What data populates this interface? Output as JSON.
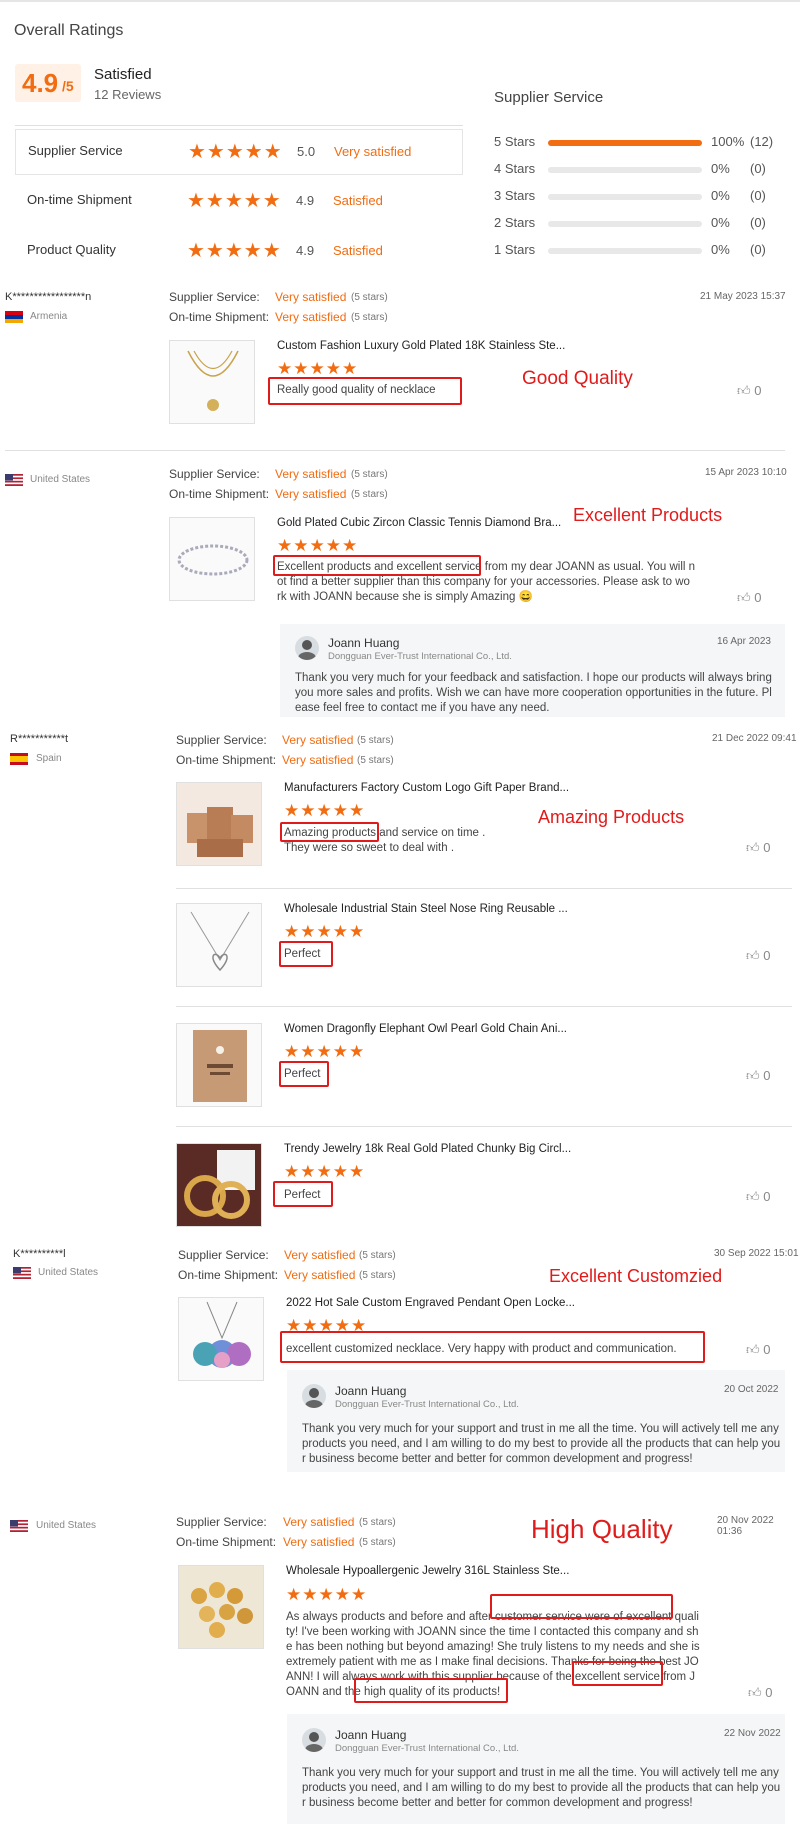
{
  "overall": {
    "title": "Overall Ratings",
    "score": "4.9",
    "score_den": "/5",
    "label": "Satisfied",
    "reviews": "12 Reviews"
  },
  "ratings": [
    {
      "name": "Supplier Service",
      "value": "5.0",
      "desc": "Very satisfied",
      "stars": 5
    },
    {
      "name": "On-time Shipment",
      "value": "4.9",
      "desc": "Satisfied",
      "stars": 5
    },
    {
      "name": "Product Quality",
      "value": "4.9",
      "desc": "Satisfied",
      "stars": 5
    }
  ],
  "supplier_service": {
    "title": "Supplier Service",
    "bars": [
      {
        "label": "5 Stars",
        "fraction": 1.0,
        "pct": "100%",
        "count": "(12)"
      },
      {
        "label": "4 Stars",
        "fraction": 0,
        "pct": "0%",
        "count": "(0)"
      },
      {
        "label": "3 Stars",
        "fraction": 0,
        "pct": "0%",
        "count": "(0)"
      },
      {
        "label": "2 Stars",
        "fraction": 0,
        "pct": "0%",
        "count": "(0)"
      },
      {
        "label": "1 Stars",
        "fraction": 0,
        "pct": "0%",
        "count": "(0)"
      }
    ]
  },
  "labels": {
    "supplier_service": "Supplier Service:",
    "ontime": "On-time Shipment:",
    "very_satisfied": "Very satisfied",
    "five_stars": "(5 stars)",
    "star_glyphs": "★★★★★",
    "likes": "0"
  },
  "reviews": [
    {
      "user": "K*****************n",
      "country": "Armenia",
      "date": "21 May 2023 15:37",
      "items": [
        {
          "title": "Custom Fashion Luxury Gold Plated 18K Stainless Ste...",
          "text": "Really good quality of necklace"
        }
      ],
      "annotation": "Good Quality"
    },
    {
      "user": "",
      "country": "United States",
      "date": "15 Apr 2023 10:10",
      "items": [
        {
          "title": "Gold Plated Cubic Zircon Classic Tennis Diamond Bra...",
          "text_lines": [
            "Excellent products and excellent service from my dear JOANN as usual. You will n",
            "ot find a better supplier than this company for your accessories. Please ask to wo",
            "rk with JOANN because she is simply Amazing 😄"
          ]
        }
      ],
      "annotation": "Excellent Products",
      "reply": {
        "name": "Joann Huang",
        "company": "Dongguan Ever-Trust International Co., Ltd.",
        "date": "16 Apr 2023",
        "lines": [
          "Thank you very much for your feedback and satisfaction. I hope our products will always bring",
          "you more sales and profits. Wish we can have more cooperation opportunities in the future. Pl",
          "ease feel free to contact me if you have any need."
        ]
      }
    },
    {
      "user": "R***********t",
      "country": "Spain",
      "date": "21 Dec 2022 09:41",
      "items": [
        {
          "title": "Manufacturers Factory Custom Logo Gift Paper Brand...",
          "text_lines": [
            "Amazing products and service on time .",
            "They were so sweet to deal with ."
          ]
        },
        {
          "title": "Wholesale Industrial Stain Steel Nose Ring Reusable ...",
          "text": "Perfect"
        },
        {
          "title": "Women Dragonfly Elephant Owl Pearl Gold Chain Ani...",
          "text": "Perfect"
        },
        {
          "title": "Trendy Jewelry 18k Real Gold Plated Chunky Big Circl...",
          "text": "Perfect"
        }
      ],
      "annotation": "Amazing Products"
    },
    {
      "user": "K**********l",
      "country": "United States",
      "date": "30 Sep 2022 15:01",
      "items": [
        {
          "title": "2022 Hot Sale Custom Engraved Pendant Open Locke...",
          "text": "excellent customized necklace.  Very happy with product and communication."
        }
      ],
      "annotation": "Excellent Customzied",
      "reply": {
        "name": "Joann Huang",
        "company": "Dongguan Ever-Trust International Co., Ltd.",
        "date": "20 Oct 2022",
        "lines": [
          "Thank you very much for your support and trust in me all the time. You will actively tell me any",
          "products you need, and I am willing to do my best to provide all the products that can help you",
          "r business become better and better for common development and progress!"
        ]
      }
    },
    {
      "user": "",
      "country": "United States",
      "date": "20 Nov 2022 01:36",
      "items": [
        {
          "title": "Wholesale Hypoallergenic Jewelry 316L Stainless Ste...",
          "text_lines": [
            "As always products and before and after customer service were of excellent quali",
            "ty! I've been working with JOANN since the time I contacted this company and sh",
            "e has been nothing but beyond amazing! She truly listens to my needs and she is",
            "extremely patient with me as I make final decisions. Thanks for being the best JO",
            "ANN! I will always work with this supplier because of the excellent service from J",
            "OANN and the high quality of its products!"
          ]
        }
      ],
      "annotation": "High Quality",
      "reply": {
        "name": "Joann Huang",
        "company": "Dongguan Ever-Trust International Co., Ltd.",
        "date": "22 Nov 2022",
        "lines": [
          "Thank you very much for your support and trust in me all the time. You will actively tell me any",
          "products you need, and I am willing to do my best to provide all the products that can help you",
          "r business become better and better for common development and progress!"
        ]
      }
    }
  ],
  "colors": {
    "accent": "#f26c11",
    "highlight": "#e01b1b"
  }
}
